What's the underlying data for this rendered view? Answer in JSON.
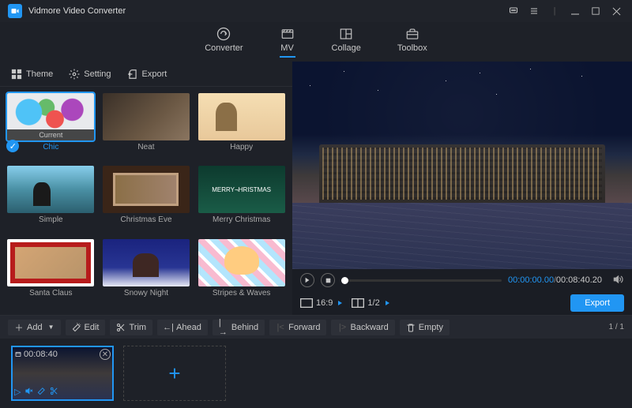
{
  "app": {
    "title": "Vidmore Video Converter"
  },
  "topnav": {
    "converter": "Converter",
    "mv": "MV",
    "collage": "Collage",
    "toolbox": "Toolbox"
  },
  "subtabs": {
    "theme": "Theme",
    "setting": "Setting",
    "export": "Export"
  },
  "themes": [
    {
      "name": "Chic",
      "current_label": "Current",
      "selected": true
    },
    {
      "name": "Neat"
    },
    {
      "name": "Happy"
    },
    {
      "name": "Simple"
    },
    {
      "name": "Christmas Eve"
    },
    {
      "name": "Merry Christmas"
    },
    {
      "name": "Santa Claus"
    },
    {
      "name": "Snowy Night"
    },
    {
      "name": "Stripes & Waves"
    }
  ],
  "preview": {
    "time_current": "00:00:00.00",
    "time_total": "00:08:40.20",
    "aspect": "16:9",
    "split": "1/2",
    "export_label": "Export"
  },
  "toolbar": {
    "add": "Add",
    "edit": "Edit",
    "trim": "Trim",
    "ahead": "Ahead",
    "behind": "Behind",
    "forward": "Forward",
    "backward": "Backward",
    "empty": "Empty",
    "pager": "1 / 1"
  },
  "timeline": {
    "clip_duration": "00:08:40"
  }
}
